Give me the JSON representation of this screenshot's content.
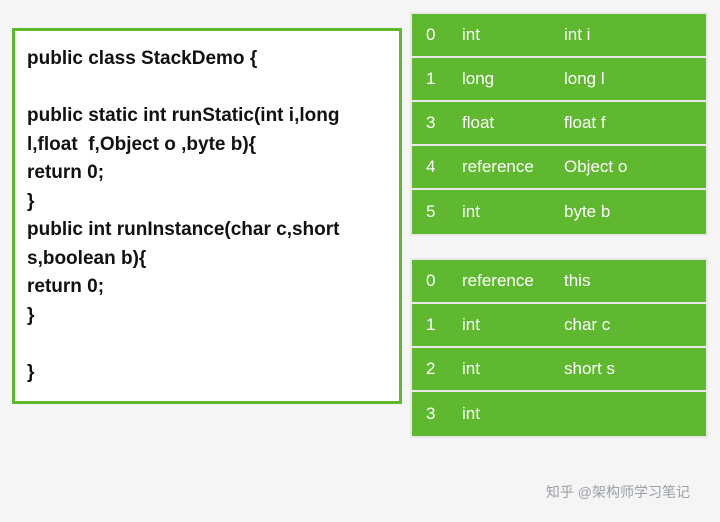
{
  "code": "public class StackDemo {\n\npublic static int runStatic(int i,long l,float  f,Object o ,byte b){\nreturn 0;\n}\npublic int runInstance(char c,short s,boolean b){\nreturn 0;\n}\n\n}",
  "table1": {
    "rows": [
      {
        "index": "0",
        "type": "int",
        "name": "int i"
      },
      {
        "index": "1",
        "type": "long",
        "name": "long l"
      },
      {
        "index": "3",
        "type": "float",
        "name": "float f"
      },
      {
        "index": "4",
        "type": "reference",
        "name": "Object o"
      },
      {
        "index": "5",
        "type": "int",
        "name": "byte b"
      }
    ]
  },
  "table2": {
    "rows": [
      {
        "index": "0",
        "type": "reference",
        "name": "this"
      },
      {
        "index": "1",
        "type": "int",
        "name": "char c"
      },
      {
        "index": "2",
        "type": "int",
        "name": "short s"
      },
      {
        "index": "3",
        "type": "int",
        "name": ""
      }
    ]
  },
  "watermark": "知乎 @架构师学习笔记"
}
